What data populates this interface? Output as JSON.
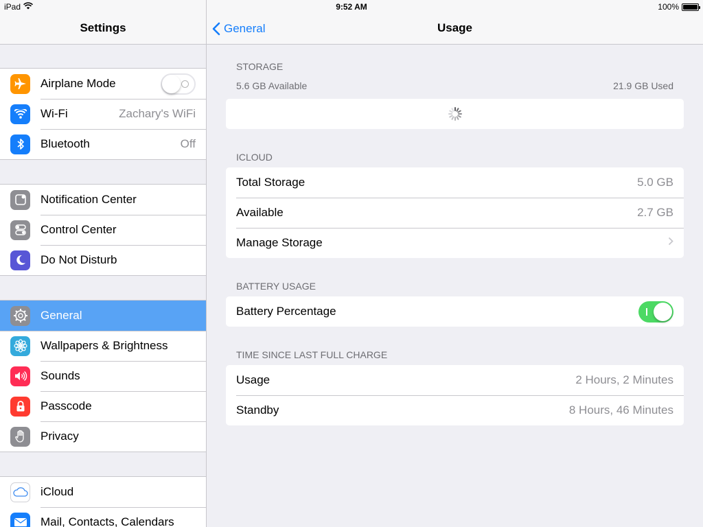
{
  "status_bar": {
    "device": "iPad",
    "time": "9:52 AM",
    "battery_text": "100%",
    "battery_level": 1.0
  },
  "sidebar": {
    "title": "Settings",
    "groups": [
      [
        {
          "label": "Airplane Mode",
          "icon": "airplane-icon",
          "color": "#ff9500",
          "control": "toggle-off"
        },
        {
          "label": "Wi-Fi",
          "icon": "wifi-icon",
          "color": "#157efb",
          "value": "Zachary's WiFi"
        },
        {
          "label": "Bluetooth",
          "icon": "bluetooth-icon",
          "color": "#157efb",
          "value": "Off"
        }
      ],
      [
        {
          "label": "Notification Center",
          "icon": "notification-center-icon",
          "color": "#8e8e93"
        },
        {
          "label": "Control Center",
          "icon": "control-center-icon",
          "color": "#8e8e93"
        },
        {
          "label": "Do Not Disturb",
          "icon": "moon-icon",
          "color": "#5856d6"
        }
      ],
      [
        {
          "label": "General",
          "icon": "gear-icon",
          "color": "#8e8e93",
          "selected": true
        },
        {
          "label": "Wallpapers & Brightness",
          "icon": "flower-icon",
          "color": "#34aadc"
        },
        {
          "label": "Sounds",
          "icon": "speaker-icon",
          "color": "#ff2d55"
        },
        {
          "label": "Passcode",
          "icon": "lock-icon",
          "color": "#ff3b30"
        },
        {
          "label": "Privacy",
          "icon": "hand-icon",
          "color": "#8e8e93"
        }
      ],
      [
        {
          "label": "iCloud",
          "icon": "cloud-icon",
          "color": "#ffffff"
        },
        {
          "label": "Mail, Contacts, Calendars",
          "icon": "mail-icon",
          "color": "#157efb"
        }
      ]
    ]
  },
  "nav": {
    "back_label": "General",
    "title": "Usage"
  },
  "storage": {
    "header": "STORAGE",
    "available": "5.6 GB Available",
    "used": "21.9 GB Used"
  },
  "icloud": {
    "header": "ICLOUD",
    "rows": [
      {
        "label": "Total Storage",
        "value": "5.0 GB"
      },
      {
        "label": "Available",
        "value": "2.7 GB"
      },
      {
        "label": "Manage Storage",
        "value": ""
      }
    ]
  },
  "battery_usage": {
    "header": "BATTERY USAGE",
    "percentage_label": "Battery Percentage",
    "percentage_on": true
  },
  "time_since_charge": {
    "header": "TIME SINCE LAST FULL CHARGE",
    "rows": [
      {
        "label": "Usage",
        "value": "2 Hours, 2 Minutes"
      },
      {
        "label": "Standby",
        "value": "8 Hours, 46 Minutes"
      }
    ]
  },
  "colors": {
    "accent": "#157efb",
    "selected_row": "#58a3f5",
    "toggle_on": "#4cd964"
  }
}
